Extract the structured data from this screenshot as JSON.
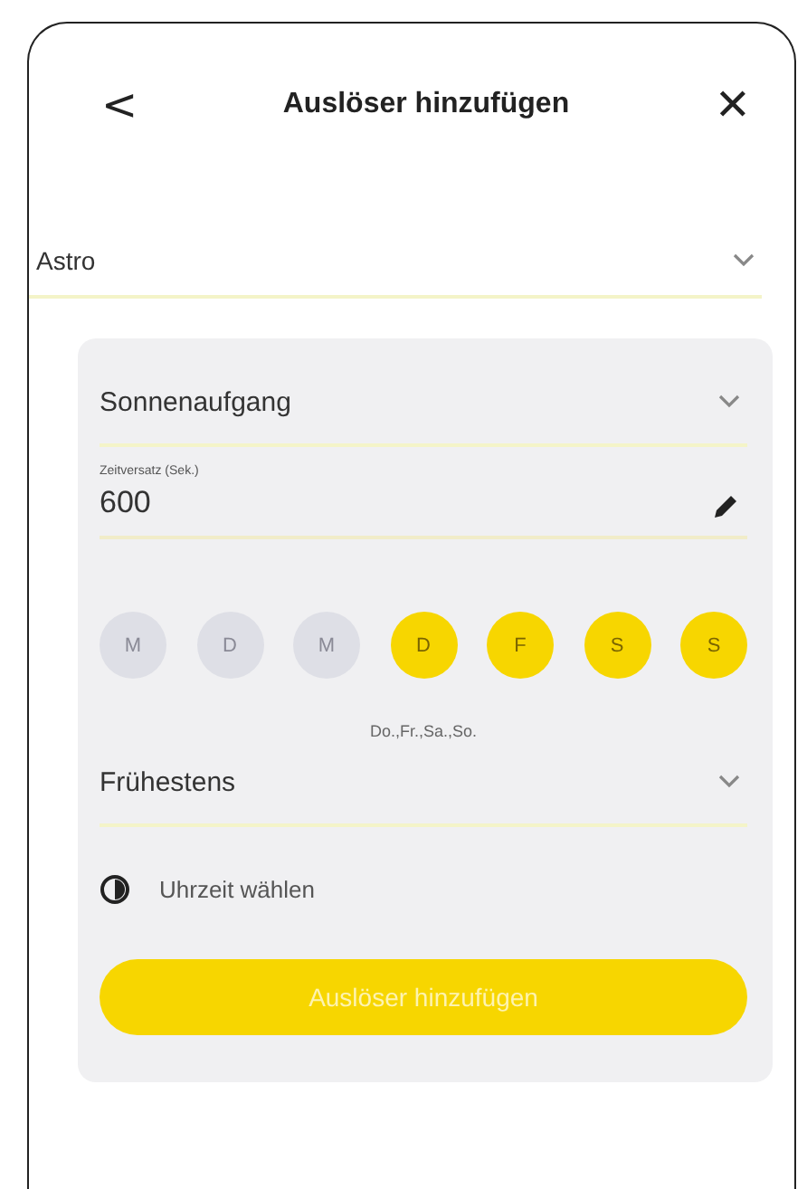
{
  "header": {
    "back": "<",
    "title": "Auslöser hinzufügen",
    "close": "✕"
  },
  "type_select": {
    "value": "Astro"
  },
  "event_select": {
    "value": "Sonnenaufgang"
  },
  "offset": {
    "label": "Zeitversatz (Sek.)",
    "value": "600"
  },
  "days": [
    {
      "label": "M",
      "selected": false
    },
    {
      "label": "D",
      "selected": false
    },
    {
      "label": "M",
      "selected": false
    },
    {
      "label": "D",
      "selected": true
    },
    {
      "label": "F",
      "selected": true
    },
    {
      "label": "S",
      "selected": true
    },
    {
      "label": "S",
      "selected": true
    }
  ],
  "days_summary": "Do.,Fr.,Sa.,So.",
  "earliest_select": {
    "value": "Frühestens"
  },
  "time_option": {
    "label": "Uhrzeit wählen"
  },
  "submit": {
    "label": "Auslöser hinzufügen"
  }
}
